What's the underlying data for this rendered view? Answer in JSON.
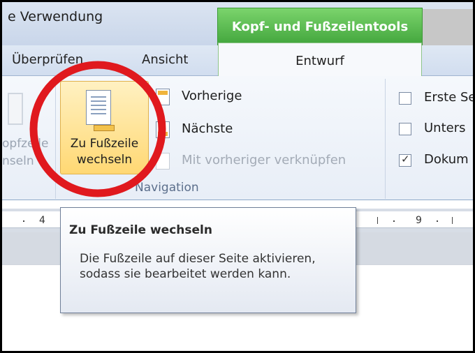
{
  "window": {
    "title_fragment": "e Verwendung"
  },
  "context_tab": {
    "title": "Kopf- und Fußzeilentools",
    "color": "#4cb043"
  },
  "tabs": [
    {
      "label": "Überprüfen"
    },
    {
      "label": "Ansicht"
    },
    {
      "label": "Entwurf",
      "active": true
    }
  ],
  "ribbon": {
    "faded_left": {
      "line1": "opfzeile",
      "line2": "nseln"
    },
    "big_button": {
      "line1": "Zu Fußzeile",
      "line2": "wechseln",
      "icon": "footer-page-icon",
      "highlighted": true
    },
    "small_items": [
      {
        "label": "Vorherige",
        "icon": "previous-section-icon",
        "enabled": true
      },
      {
        "label": "Nächste",
        "icon": "next-section-icon",
        "enabled": true
      },
      {
        "label": "Mit vorheriger verknüpfen",
        "icon": "link-to-previous-icon",
        "enabled": false
      }
    ],
    "group_label": "Navigation",
    "options": [
      {
        "label": "Erste Se",
        "checked": false
      },
      {
        "label": "Unters",
        "checked": false
      },
      {
        "label": "Dokum",
        "checked": true
      }
    ]
  },
  "ruler": {
    "left_number": "4",
    "right_number": "9"
  },
  "tooltip": {
    "title": "Zu Fußzeile wechseln",
    "body": "Die Fußzeile auf dieser Seite aktivieren, sodass sie bearbeitet werden kann."
  },
  "annotation_color": "#e0191e"
}
